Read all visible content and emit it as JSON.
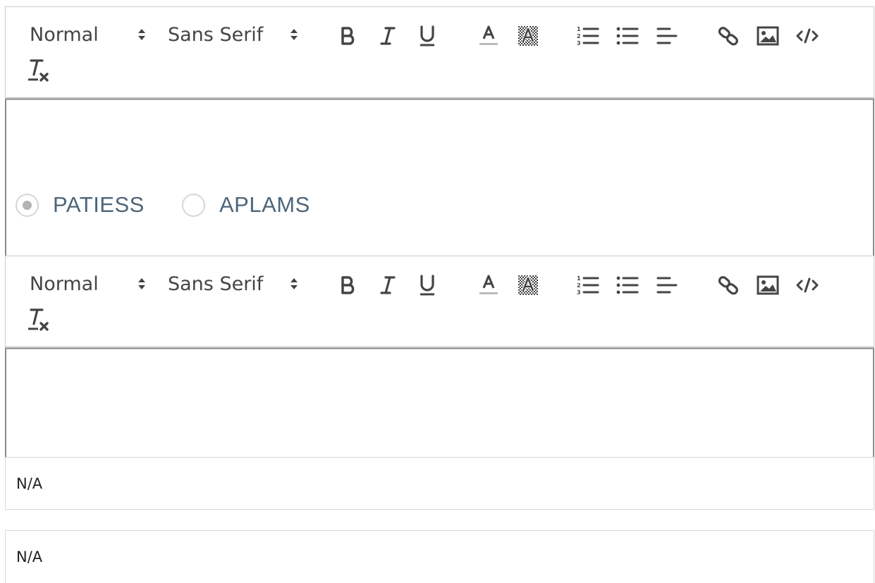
{
  "toolbar1": {
    "header_select": "Normal",
    "font_select": "Sans Serif"
  },
  "toolbar2": {
    "header_select": "Normal",
    "font_select": "Sans Serif"
  },
  "icons": [
    "chevron-up-down-icon",
    "bold-icon",
    "italic-icon",
    "underline-icon",
    "font-color-icon",
    "background-color-icon",
    "ordered-list-icon",
    "bullet-list-icon",
    "align-left-icon",
    "link-icon",
    "image-icon",
    "code-icon",
    "clear-format-icon"
  ],
  "radio_group": {
    "options": [
      {
        "label": "PATIESS",
        "selected": true
      },
      {
        "label": "APLAMS",
        "selected": false
      }
    ]
  },
  "fields": {
    "field1_value": "N/A",
    "field2_value": "N/A"
  }
}
